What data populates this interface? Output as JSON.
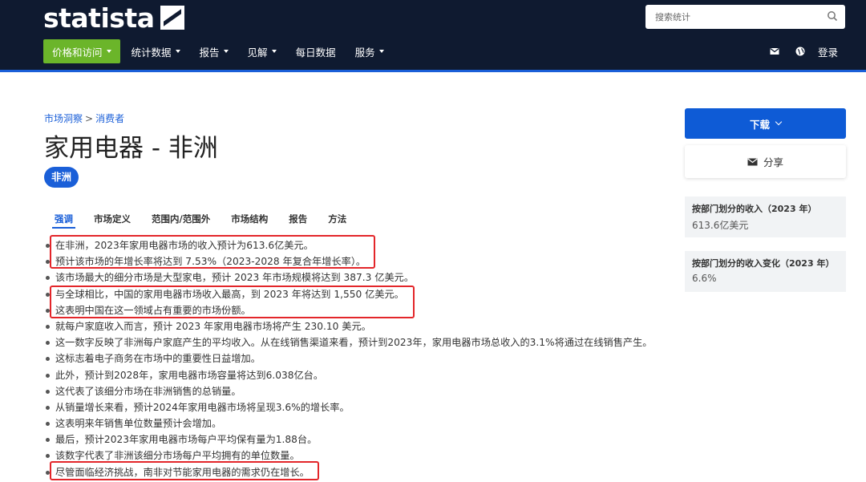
{
  "header": {
    "logo_text": "statista",
    "search_placeholder": "搜索统计",
    "nav": [
      {
        "label": "价格和访问"
      },
      {
        "label": "统计数据"
      },
      {
        "label": "报告"
      },
      {
        "label": "见解"
      },
      {
        "label": "每日数据"
      },
      {
        "label": "服务"
      }
    ],
    "login_label": "登录",
    "icons": [
      "search-icon",
      "mail-icon",
      "globe-icon"
    ],
    "colors": {
      "bg": "#0f1a30",
      "accent": "#6bb52a",
      "brand_blue": "#1a5fd8"
    }
  },
  "breadcrumb": {
    "item1": "市场洞察",
    "separator": ">",
    "item2": "消费者"
  },
  "page_title": "家用电器 - 非洲",
  "region_badge": "非洲",
  "tabs": [
    {
      "label": "强调",
      "active": true
    },
    {
      "label": "市场定义",
      "active": false
    },
    {
      "label": "范围内/范围外",
      "active": false
    },
    {
      "label": "市场结构",
      "active": false
    },
    {
      "label": "报告",
      "active": false
    },
    {
      "label": "方法",
      "active": false
    }
  ],
  "bullets": [
    "在非洲，2023年家用电器市场的收入预计为613.6亿美元。",
    "预计该市场的年增长率将达到 7.53%（2023-2028 年复合年增长率）。",
    "该市场最大的细分市场是大型家电，预计 2023 年市场规模将达到 387.3 亿美元。",
    "与全球相比，中国的家用电器市场收入最高，到 2023 年将达到 1,550 亿美元。",
    "这表明中国在这一领域占有重要的市场份额。",
    "就每户家庭收入而言，预计 2023 年家用电器市场将产生 230.10 美元。",
    "这一数字反映了非洲每户家庭产生的平均收入。从在线销售渠道来看，预计到2023年，家用电器市场总收入的3.1%将通过在线销售产生。",
    "这标志着电子商务在市场中的重要性日益增加。",
    "此外，预计到2028年，家用电器市场容量将达到6.038亿台。",
    "这代表了该细分市场在非洲销售的总销量。",
    "从销量增长来看，预计2024年家用电器市场将呈现3.6%的增长率。",
    "这表明来年销售单位数量预计会增加。",
    "最后，预计2023年家用电器市场每户平均保有量为1.88台。",
    "该数字代表了非洲该细分市场每户平均拥有的单位数量。",
    "尽管面临经济挑战，南非对节能家用电器的需求仍在增长。"
  ],
  "sidebar": {
    "download_label": "下载",
    "share_label": "分享",
    "kpis": [
      {
        "label": "按部门划分的收入（2023 年）",
        "value": "613.6亿美元"
      },
      {
        "label": "按部门划分的收入变化（2023 年）",
        "value": "6.6%"
      }
    ]
  }
}
